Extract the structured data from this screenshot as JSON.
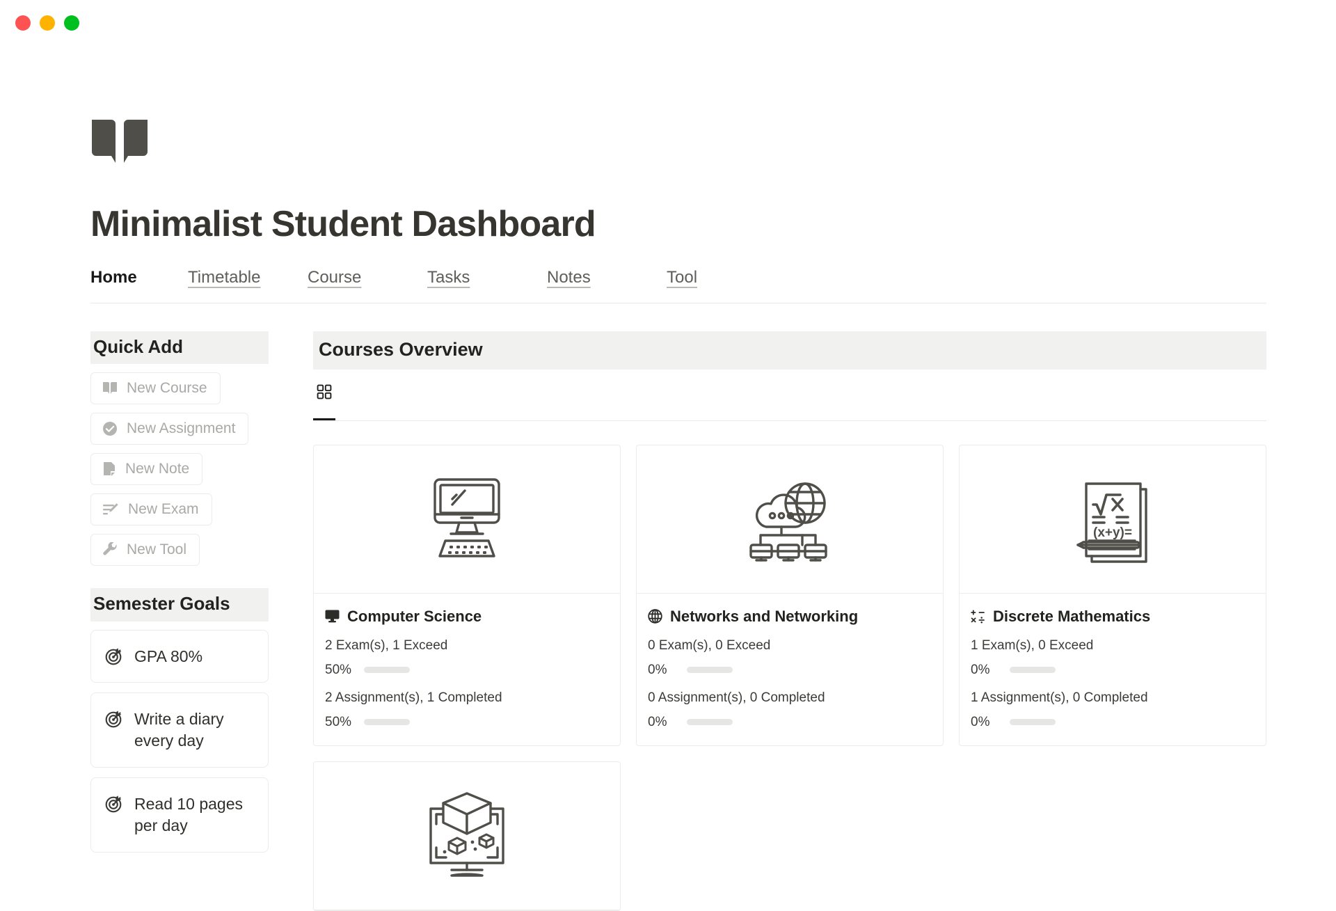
{
  "window": {
    "controls": [
      {
        "name": "close",
        "color": "#ff5252"
      },
      {
        "name": "minimize",
        "color": "#ffb300"
      },
      {
        "name": "zoom",
        "color": "#00c020"
      }
    ]
  },
  "header": {
    "logo_icon": "open-book-icon",
    "title": "Minimalist Student Dashboard"
  },
  "nav": {
    "items": [
      {
        "label": "Home",
        "active": true
      },
      {
        "label": "Timetable",
        "active": false
      },
      {
        "label": "Course",
        "active": false
      },
      {
        "label": "Tasks",
        "active": false
      },
      {
        "label": "Notes",
        "active": false
      },
      {
        "label": "Tool",
        "active": false
      }
    ]
  },
  "sidebar": {
    "quick_add": {
      "heading": "Quick Add",
      "buttons": [
        {
          "label": "New Course",
          "icon": "book-icon"
        },
        {
          "label": "New Assignment",
          "icon": "check-circle-icon"
        },
        {
          "label": "New Note",
          "icon": "note-icon"
        },
        {
          "label": "New Exam",
          "icon": "exam-pencil-icon"
        },
        {
          "label": "New Tool",
          "icon": "wrench-icon"
        }
      ]
    },
    "semester_goals": {
      "heading": "Semester Goals",
      "items": [
        {
          "label": "GPA 80%",
          "icon": "target-icon"
        },
        {
          "label": "Write a diary every day",
          "icon": "target-icon"
        },
        {
          "label": "Read 10 pages per day",
          "icon": "target-icon"
        }
      ]
    }
  },
  "main": {
    "heading": "Courses Overview",
    "view_tabs": [
      {
        "label": "",
        "icon": "gallery-grid-icon",
        "active": true
      }
    ],
    "courses": [
      {
        "title": "Computer Science",
        "title_icon": "desktop-icon",
        "thumb_icon": "computer-monitor-keyboard-illustration",
        "exams_text": "2 Exam(s), 1 Exceed",
        "exams_pct": "50%",
        "exams_value": 50,
        "assignments_text": "2 Assignment(s), 1 Completed",
        "assignments_pct": "50%",
        "assignments_value": 50
      },
      {
        "title": "Networks and Networking",
        "title_icon": "globe-icon",
        "thumb_icon": "cloud-network-servers-illustration",
        "exams_text": "0 Exam(s), 0 Exceed",
        "exams_pct": "0%",
        "exams_value": 0,
        "assignments_text": "0 Assignment(s), 0 Completed",
        "assignments_pct": "0%",
        "assignments_value": 0
      },
      {
        "title": "Discrete Mathematics",
        "title_icon": "math-symbols-icon",
        "thumb_icon": "math-notebook-pencil-illustration",
        "exams_text": "1 Exam(s), 0 Exceed",
        "exams_pct": "0%",
        "exams_value": 0,
        "assignments_text": "1 Assignment(s), 0 Completed",
        "assignments_pct": "0%",
        "assignments_value": 0
      },
      {
        "title": "",
        "title_icon": "",
        "thumb_icon": "3d-cube-monitor-illustration",
        "exams_text": "",
        "exams_pct": "",
        "exams_value": 0,
        "assignments_text": "",
        "assignments_pct": "",
        "assignments_value": 0
      }
    ]
  },
  "colors": {
    "ink": "#37352f",
    "muted": "#a9a9a6",
    "band": "#f1f1ef",
    "line_art": "#4f4e49",
    "progress_fill": "#8c8c88",
    "progress_track": "#e6e6e4"
  }
}
